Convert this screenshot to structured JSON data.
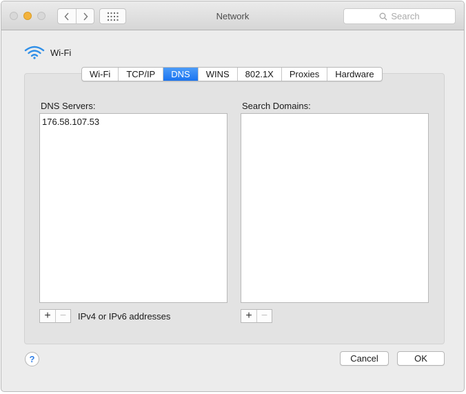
{
  "window": {
    "title": "Network",
    "search_placeholder": "Search"
  },
  "interface": {
    "name": "Wi-Fi",
    "icon": "wifi-icon"
  },
  "tabs": [
    {
      "label": "Wi-Fi",
      "active": false
    },
    {
      "label": "TCP/IP",
      "active": false
    },
    {
      "label": "DNS",
      "active": true
    },
    {
      "label": "WINS",
      "active": false
    },
    {
      "label": "802.1X",
      "active": false
    },
    {
      "label": "Proxies",
      "active": false
    },
    {
      "label": "Hardware",
      "active": false
    }
  ],
  "dns": {
    "label": "DNS Servers:",
    "servers": [
      "176.58.107.53"
    ],
    "hint": "IPv4 or IPv6 addresses"
  },
  "search_domains": {
    "label": "Search Domains:",
    "domains": []
  },
  "controls": {
    "add": "+",
    "remove": "−",
    "help": "?"
  },
  "buttons": {
    "cancel": "Cancel",
    "ok": "OK"
  },
  "colors": {
    "accent": "#1b74f0",
    "minimize": "#f3b33d"
  }
}
